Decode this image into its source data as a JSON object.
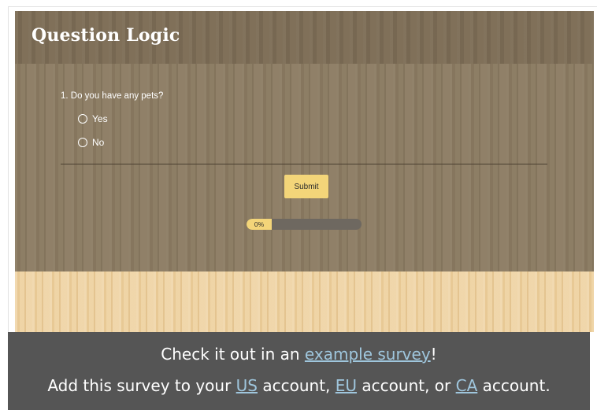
{
  "header": {
    "title": "Question Logic"
  },
  "question": {
    "title": "1. Do you have any pets?",
    "options": [
      "Yes",
      "No"
    ]
  },
  "submit_label": "Submit",
  "progress": {
    "label": "0%",
    "value": 0
  },
  "banner": {
    "line1_prefix": "Check it out in an ",
    "line1_link": "example survey",
    "line1_suffix": "!",
    "line2_prefix": "Add this survey to your ",
    "us_link": "US",
    "mid1": " account, ",
    "eu_link": "EU",
    "mid2": " account, or ",
    "ca_link": "CA",
    "line2_suffix": " account."
  },
  "colors": {
    "accent": "#f3d579",
    "banner_bg": "#555555",
    "link": "#9fc6dd"
  }
}
